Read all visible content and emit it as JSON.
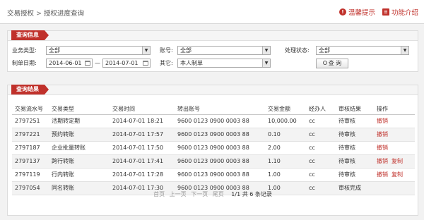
{
  "breadcrumb": {
    "parent": "交易授权",
    "separator": ">",
    "current": "授权进度查询"
  },
  "top_links": {
    "tips": "温馨提示",
    "help": "功能介绍"
  },
  "query_panel": {
    "title": "查询信息",
    "trade_type_label": "业务类型:",
    "trade_type_value": "全部",
    "account_label": "账号:",
    "account_value": "全部",
    "status_label": "处理状态:",
    "status_value": "全部",
    "date_label": "制单日期:",
    "date_from": "2014-06-01",
    "date_to": "2014-07-01",
    "date_sep": "—",
    "other_label": "其它:",
    "other_value": "本人制单",
    "query_button": "查 询"
  },
  "result_panel": {
    "title": "查询结果",
    "columns": [
      "交易流水号",
      "交易类型",
      "交易时间",
      "转出账号",
      "交易金额",
      "经办人",
      "审核结果",
      "操作"
    ],
    "rows": [
      {
        "serial": "2797251",
        "type": "活期转定期",
        "time": "2014-07-01 18:21",
        "account": "9600 0123 0900 0003 88",
        "amount": "10,000.00",
        "handler": "cc",
        "result": "待审核",
        "ops": [
          "撤销"
        ]
      },
      {
        "serial": "2797221",
        "type": "预约转账",
        "time": "2014-07-01 17:57",
        "account": "9600 0123 0900 0003 88",
        "amount": "0.10",
        "handler": "cc",
        "result": "待审核",
        "ops": [
          "撤销"
        ]
      },
      {
        "serial": "2797187",
        "type": "企业批量转账",
        "time": "2014-07-01 17:50",
        "account": "9600 0123 0900 0003 88",
        "amount": "2.00",
        "handler": "cc",
        "result": "待审核",
        "ops": [
          "撤销"
        ]
      },
      {
        "serial": "2797137",
        "type": "跨行转账",
        "time": "2014-07-01 17:41",
        "account": "9600 0123 0900 0003 88",
        "amount": "1.10",
        "handler": "cc",
        "result": "待审核",
        "ops": [
          "撤销",
          "复制"
        ]
      },
      {
        "serial": "2797119",
        "type": "行内转账",
        "time": "2014-07-01 17:28",
        "account": "9600 0123 0900 0003 88",
        "amount": "1.00",
        "handler": "cc",
        "result": "待审核",
        "ops": [
          "撤销",
          "复制"
        ]
      },
      {
        "serial": "2797054",
        "type": "同名转账",
        "time": "2014-07-01 17:30",
        "account": "9600 0123 0900 0003 88",
        "amount": "1.00",
        "handler": "cc",
        "result": "审核完成",
        "ops": []
      }
    ]
  },
  "pager": {
    "first": "首页",
    "prev": "上一页",
    "next": "下一页",
    "last": "尾页",
    "info": "1/1 共 6 条记录"
  },
  "colors": {
    "accent": "#c0312b",
    "background": "#f2f2f2"
  },
  "icons": {
    "tips": "alert-circle-icon",
    "help": "book-icon",
    "query": "search-icon",
    "calendar": "calendar-icon",
    "dropdown": "chevron-down-icon"
  }
}
